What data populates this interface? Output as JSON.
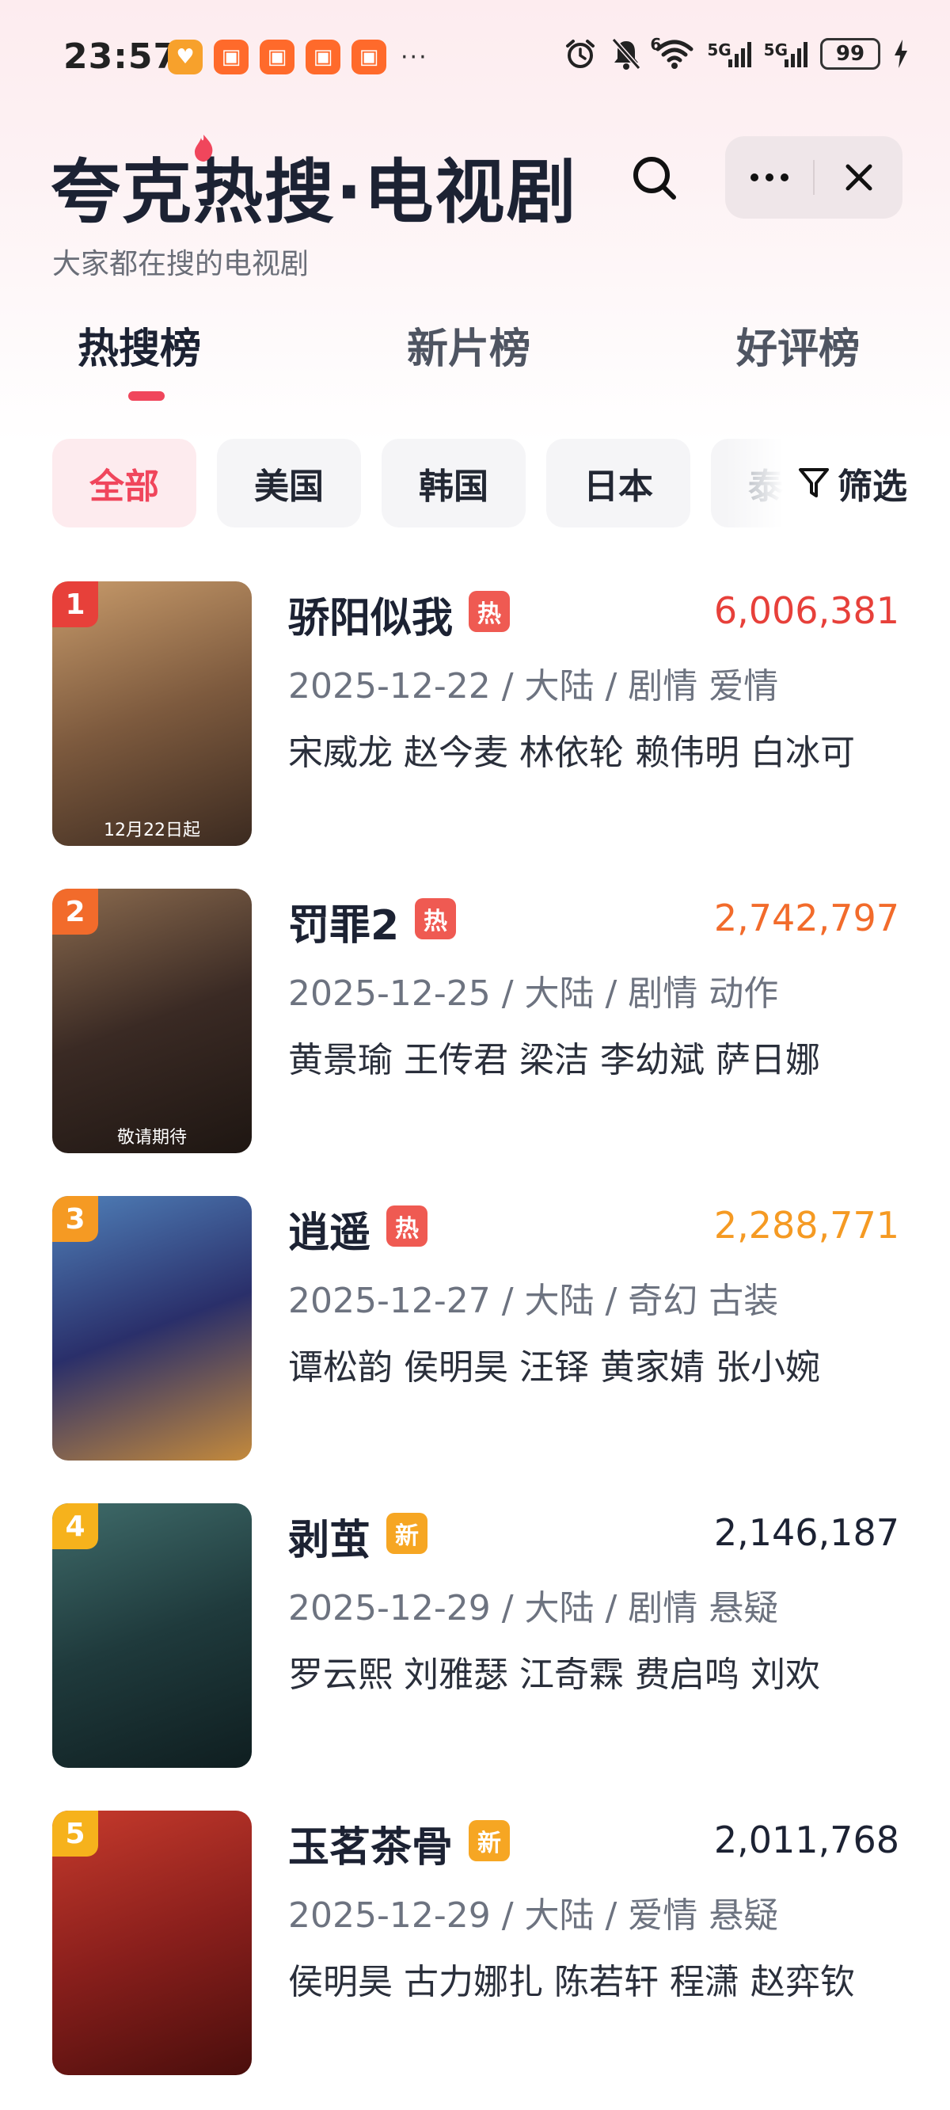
{
  "status_bar": {
    "time": "23:57",
    "app_icons": [
      {
        "name": "heart-app-icon",
        "color": "#f7a12c",
        "glyph": "♥"
      },
      {
        "name": "video-app-icon-1",
        "color": "#ff6a2b",
        "glyph": "▣"
      },
      {
        "name": "video-app-icon-2",
        "color": "#ff6a2b",
        "glyph": "▣"
      },
      {
        "name": "video-app-icon-3",
        "color": "#ff6a2b",
        "glyph": "▣"
      },
      {
        "name": "video-app-icon-4",
        "color": "#ff6a2b",
        "glyph": "▣"
      }
    ],
    "more_dots": "···",
    "network_1": "5G",
    "network_2": "5G",
    "wifi_label": "6",
    "battery": "99"
  },
  "header": {
    "title": "夸克热搜·电视剧",
    "subtitle": "大家都在搜的电视剧"
  },
  "tabs": [
    {
      "label": "热搜榜",
      "active": true
    },
    {
      "label": "新片榜",
      "active": false
    },
    {
      "label": "好评榜",
      "active": false
    }
  ],
  "chips": [
    {
      "label": "全部",
      "active": true
    },
    {
      "label": "美国",
      "active": false
    },
    {
      "label": "韩国",
      "active": false
    },
    {
      "label": "日本",
      "active": false
    },
    {
      "label": "泰国",
      "active": false
    }
  ],
  "filter_label": "筛选",
  "colors": {
    "accent": "#f0465c",
    "rank1": "#e7403a",
    "rank2": "#f26b2b",
    "rank3": "#f59a23",
    "rank_other": "#f6b21c",
    "hot_tag": "#ef5a52",
    "new_tag": "#f6a623"
  },
  "items": [
    {
      "rank": "1",
      "title": "骄阳似我",
      "tag": "热",
      "tag_type": "hot",
      "score": "6,006,381",
      "meta": "2025-12-22 / 大陆 / 剧情 爱情",
      "cast": "宋威龙 赵今麦 林依轮 赖伟明 白冰可",
      "poster_caption": "12月22日起",
      "poster_colors": [
        "#7d5a3e",
        "#c79a6a",
        "#3b2a20"
      ]
    },
    {
      "rank": "2",
      "title": "罚罪2",
      "tag": "热",
      "tag_type": "hot",
      "score": "2,742,797",
      "meta": "2025-12-25 / 大陆 / 剧情 动作",
      "cast": "黄景瑜 王传君 梁洁 李幼斌 萨日娜",
      "poster_caption": "敬请期待",
      "poster_colors": [
        "#3a2a24",
        "#8a6a4e",
        "#1e1612"
      ]
    },
    {
      "rank": "3",
      "title": "逍遥",
      "tag": "热",
      "tag_type": "hot",
      "score": "2,288,771",
      "meta": "2025-12-27 / 大陆 / 奇幻 古装",
      "cast": "谭松韵 侯明昊 汪铎 黄家婧 张小婉",
      "poster_caption": "",
      "poster_colors": [
        "#2a2f6a",
        "#4f7fb8",
        "#c48a3c"
      ]
    },
    {
      "rank": "4",
      "title": "剥茧",
      "tag": "新",
      "tag_type": "new",
      "score": "2,146,187",
      "meta": "2025-12-29 / 大陆 / 剧情 悬疑",
      "cast": "罗云熙 刘雅瑟 江奇霖 费启鸣 刘欢",
      "poster_caption": "",
      "poster_colors": [
        "#1f3a3c",
        "#3f6b6a",
        "#0f1e20"
      ]
    },
    {
      "rank": "5",
      "title": "玉茗茶骨",
      "tag": "新",
      "tag_type": "new",
      "score": "2,011,768",
      "meta": "2025-12-29 / 大陆 / 爱情 悬疑",
      "cast": "侯明昊 古力娜扎 陈若轩 程潇 赵弈钦",
      "poster_caption": "",
      "poster_colors": [
        "#8a1f1c",
        "#c63a2c",
        "#4a0e0c"
      ]
    }
  ]
}
